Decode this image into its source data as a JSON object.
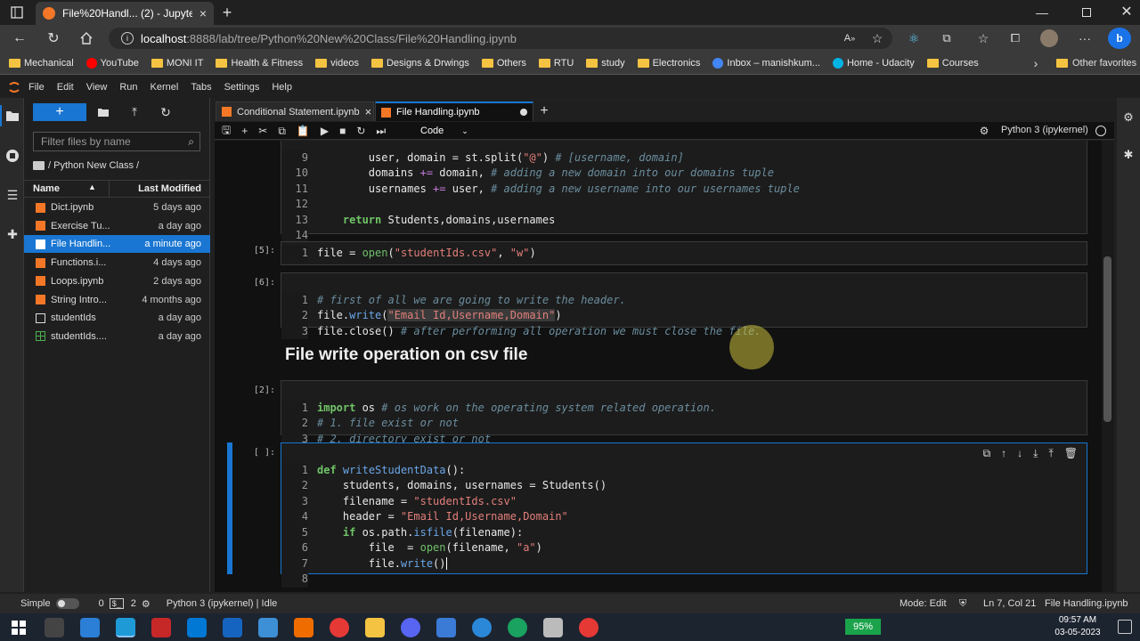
{
  "browser": {
    "tab_title": "File%20Handl... (2) - JupyterLab",
    "url_host": "localhost",
    "url_path": ":8888/lab/tree/Python%20New%20Class/File%20Handling.ipynb"
  },
  "bookmarks": [
    {
      "label": "Mechanical",
      "icon": "folder"
    },
    {
      "label": "YouTube",
      "icon": "youtube"
    },
    {
      "label": "MONI IT",
      "icon": "folder"
    },
    {
      "label": "Health & Fitness",
      "icon": "folder"
    },
    {
      "label": "videos",
      "icon": "folder"
    },
    {
      "label": "Designs & Drwings",
      "icon": "folder"
    },
    {
      "label": "Others",
      "icon": "folder"
    },
    {
      "label": "RTU",
      "icon": "folder"
    },
    {
      "label": "study",
      "icon": "folder"
    },
    {
      "label": "Electronics",
      "icon": "folder"
    },
    {
      "label": "Inbox – manishkum...",
      "icon": "google"
    },
    {
      "label": "Home - Udacity",
      "icon": "udacity"
    },
    {
      "label": "Courses",
      "icon": "folder"
    }
  ],
  "other_favorites": "Other favorites",
  "menu": [
    "File",
    "Edit",
    "View",
    "Run",
    "Kernel",
    "Tabs",
    "Settings",
    "Help"
  ],
  "filebrowser": {
    "filter_placeholder": "Filter files by name",
    "breadcrumb": "/ Python New Class /",
    "col_name": "Name",
    "col_modified": "Last Modified",
    "files": [
      {
        "name": "Dict.ipynb",
        "modified": "5 days ago",
        "type": "notebook"
      },
      {
        "name": "Exercise Tu...",
        "modified": "a day ago",
        "type": "notebook"
      },
      {
        "name": "File Handlin...",
        "modified": "a minute ago",
        "type": "notebook",
        "selected": true
      },
      {
        "name": "Functions.i...",
        "modified": "4 days ago",
        "type": "notebook"
      },
      {
        "name": "Loops.ipynb",
        "modified": "2 days ago",
        "type": "notebook"
      },
      {
        "name": "String Intro...",
        "modified": "4 months ago",
        "type": "notebook"
      },
      {
        "name": "studentIds",
        "modified": "a day ago",
        "type": "file"
      },
      {
        "name": "studentIds....",
        "modified": "a day ago",
        "type": "csv"
      }
    ]
  },
  "notebook_tabs": [
    {
      "label": "Conditional Statement.ipynb",
      "active": false
    },
    {
      "label": "File Handling.ipynb",
      "active": true
    }
  ],
  "toolbar": {
    "cell_type": "Code",
    "kernel": "Python 3 (ipykernel)"
  },
  "markdown_heading": "File write operation on csv file",
  "status": {
    "mode": "Simple",
    "count1": "0",
    "count2": "2",
    "kernel_status": "Python 3 (ipykernel) | Idle",
    "edit_mode": "Mode: Edit",
    "position": "Ln 7, Col 21",
    "filename": "File Handling.ipynb"
  },
  "taskbar": {
    "battery": "95%",
    "time": "09:57 AM",
    "date": "03-05-2023"
  },
  "colors": {
    "accent": "#1976d2",
    "keyword": "#70c467",
    "string": "#e27f7a",
    "comment": "#6b8d9e"
  }
}
